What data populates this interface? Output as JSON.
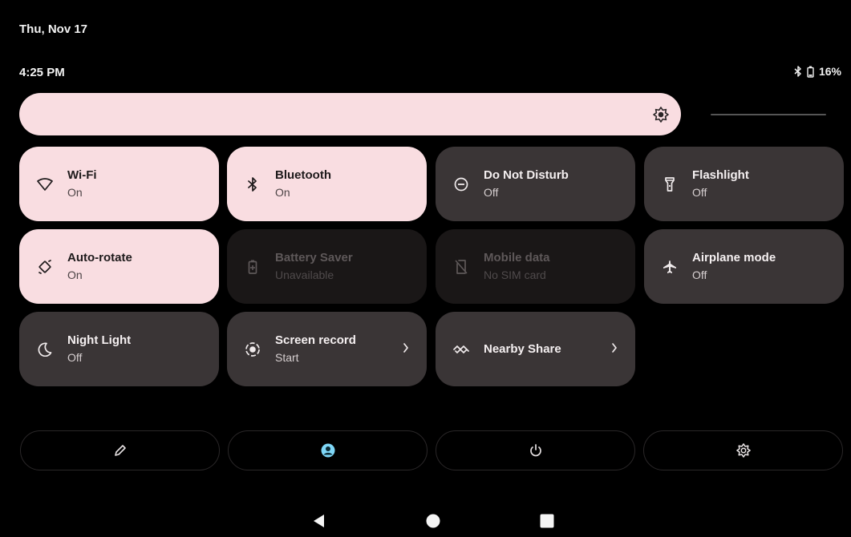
{
  "header": {
    "date": "Thu, Nov 17",
    "time": "4:25 PM"
  },
  "status_bar": {
    "battery_percent": "16%",
    "icons": [
      "bluetooth-icon",
      "battery-icon"
    ]
  },
  "brightness": {
    "level": 0.82,
    "icon": "brightness-icon"
  },
  "tiles": [
    {
      "label": "Wi-Fi",
      "sub": "On",
      "state": "on",
      "icon": "wifi-icon"
    },
    {
      "label": "Bluetooth",
      "sub": "On",
      "state": "on",
      "icon": "bluetooth-icon"
    },
    {
      "label": "Do Not Disturb",
      "sub": "Off",
      "state": "off",
      "icon": "do-not-disturb-icon"
    },
    {
      "label": "Flashlight",
      "sub": "Off",
      "state": "off",
      "icon": "flashlight-icon"
    },
    {
      "label": "Auto-rotate",
      "sub": "On",
      "state": "on",
      "icon": "auto-rotate-icon"
    },
    {
      "label": "Battery Saver",
      "sub": "Unavailable",
      "state": "disabled",
      "icon": "battery-saver-icon"
    },
    {
      "label": "Mobile data",
      "sub": "No SIM card",
      "state": "disabled",
      "icon": "no-sim-icon"
    },
    {
      "label": "Airplane mode",
      "sub": "Off",
      "state": "off",
      "icon": "airplane-icon"
    },
    {
      "label": "Night Light",
      "sub": "Off",
      "state": "off",
      "icon": "moon-icon"
    },
    {
      "label": "Screen record",
      "sub": "Start",
      "state": "off",
      "icon": "screen-record-icon"
    },
    {
      "label": "Nearby Share",
      "sub": "",
      "state": "off",
      "icon": "nearby-share-icon"
    }
  ],
  "footer": [
    "edit-icon",
    "user-icon",
    "power-icon",
    "settings-icon"
  ],
  "navigation": [
    "back-icon",
    "home-icon",
    "recents-icon"
  ],
  "colors": {
    "tile_on": "#f9dde1",
    "tile_off": "#3a3536",
    "tile_disabled": "#1a1717",
    "accent_user": "#7fd7f7"
  }
}
